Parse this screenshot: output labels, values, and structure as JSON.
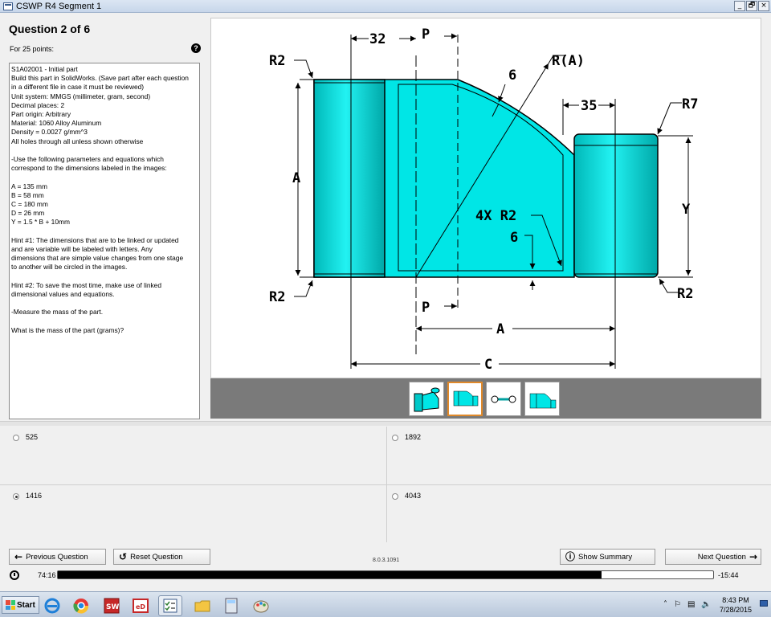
{
  "window": {
    "title": "CSWP R4 Segment 1",
    "buttons": [
      "_",
      "🗗",
      "×"
    ]
  },
  "question": {
    "title": "Question 2 of 6",
    "points": "For 25 points:",
    "help_icon": "help-icon",
    "lines": [
      "S1A02001 - Initial part",
      "Build this part in SolidWorks. (Save part after each question",
      "in a different file in case it must be reviewed)",
      "Unit system: MMGS (millimeter, gram, second)",
      "Decimal places: 2",
      "Part origin: Arbitrary",
      "Material: 1060 Alloy Aluminum",
      "Density = 0.0027 g/mm^3",
      "All holes through all unless shown otherwise",
      "",
      "-Use the following parameters and equations which",
      "correspond to the dimensions labeled in the images:",
      "",
      "A = 135 mm",
      "B = 58 mm",
      "C = 180 mm",
      "D = 26 mm",
      "Y = 1.5 * B + 10mm",
      "",
      "Hint #1: The dimensions that are to be linked or updated",
      "and are variable will be labeled with letters. Any",
      "dimensions that are simple value changes from one stage",
      "to another will be circled in the images.",
      "",
      "Hint #2: To save the most time, make use of linked",
      "dimensional values and equations.",
      "",
      "-Measure the mass of the part.",
      "",
      "What is the mass of the part (grams)?"
    ]
  },
  "drawing": {
    "labels": {
      "dim_32": "32",
      "p_top": "P",
      "r2_tl": "R2",
      "r_a": "R(A)",
      "six_top": "6",
      "dim_35": "35",
      "r7": "R7",
      "a_left": "A",
      "four_r2": "4X R2",
      "six_mid": "6",
      "y": "Y",
      "r2_bl": "R2",
      "r2_br": "R2",
      "p_bottom": "P",
      "a_bottom": "A",
      "c": "C"
    },
    "colors": {
      "part": "#00e6e6",
      "part_dark": "#00b5b5",
      "line": "#000000"
    }
  },
  "thumbnails": {
    "count": 4,
    "selected": 1
  },
  "answers": [
    {
      "label": "525",
      "checked": false
    },
    {
      "label": "1892",
      "checked": false
    },
    {
      "label": "1416",
      "checked": true
    },
    {
      "label": "4043",
      "checked": false
    }
  ],
  "nav": {
    "previous": "Previous Question",
    "reset": "Reset Question",
    "version": "8.0.3.1091",
    "summary": "Show Summary",
    "next": "Next Question"
  },
  "timer": {
    "elapsed": "74:16",
    "remaining": "-15:44",
    "progress": 0.83
  },
  "taskbar": {
    "start": "Start",
    "time": "8:43 PM",
    "date": "7/28/2015"
  }
}
